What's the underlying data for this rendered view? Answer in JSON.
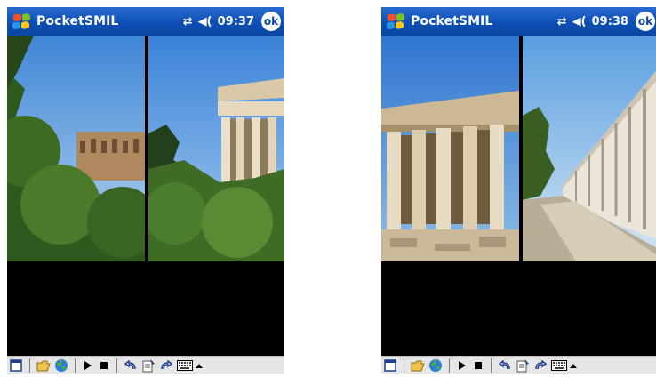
{
  "screens": [
    {
      "app_title": "PocketSMIL",
      "clock": "09:37",
      "ok_label": "ok",
      "signal_icon": "connectivity-icon",
      "volume_icon": "speaker-icon",
      "left_image": "odeon-ruins-with-trees",
      "right_image": "temple-of-hephaestus"
    },
    {
      "app_title": "PocketSMIL",
      "clock": "09:38",
      "ok_label": "ok",
      "signal_icon": "connectivity-icon",
      "volume_icon": "speaker-icon",
      "left_image": "parthenon",
      "right_image": "stoa-of-attalos"
    }
  ],
  "toolbar_icons": [
    "window-icon",
    "open-folder-icon",
    "globe-icon",
    "play-icon",
    "stop-icon",
    "undo-icon",
    "properties-icon",
    "redo-icon",
    "keyboard-icon",
    "scroll-up-icon"
  ],
  "colors": {
    "titlebar": "#0c4fb4",
    "toolbar": "#e6e6e6",
    "content_bg": "#000000"
  }
}
